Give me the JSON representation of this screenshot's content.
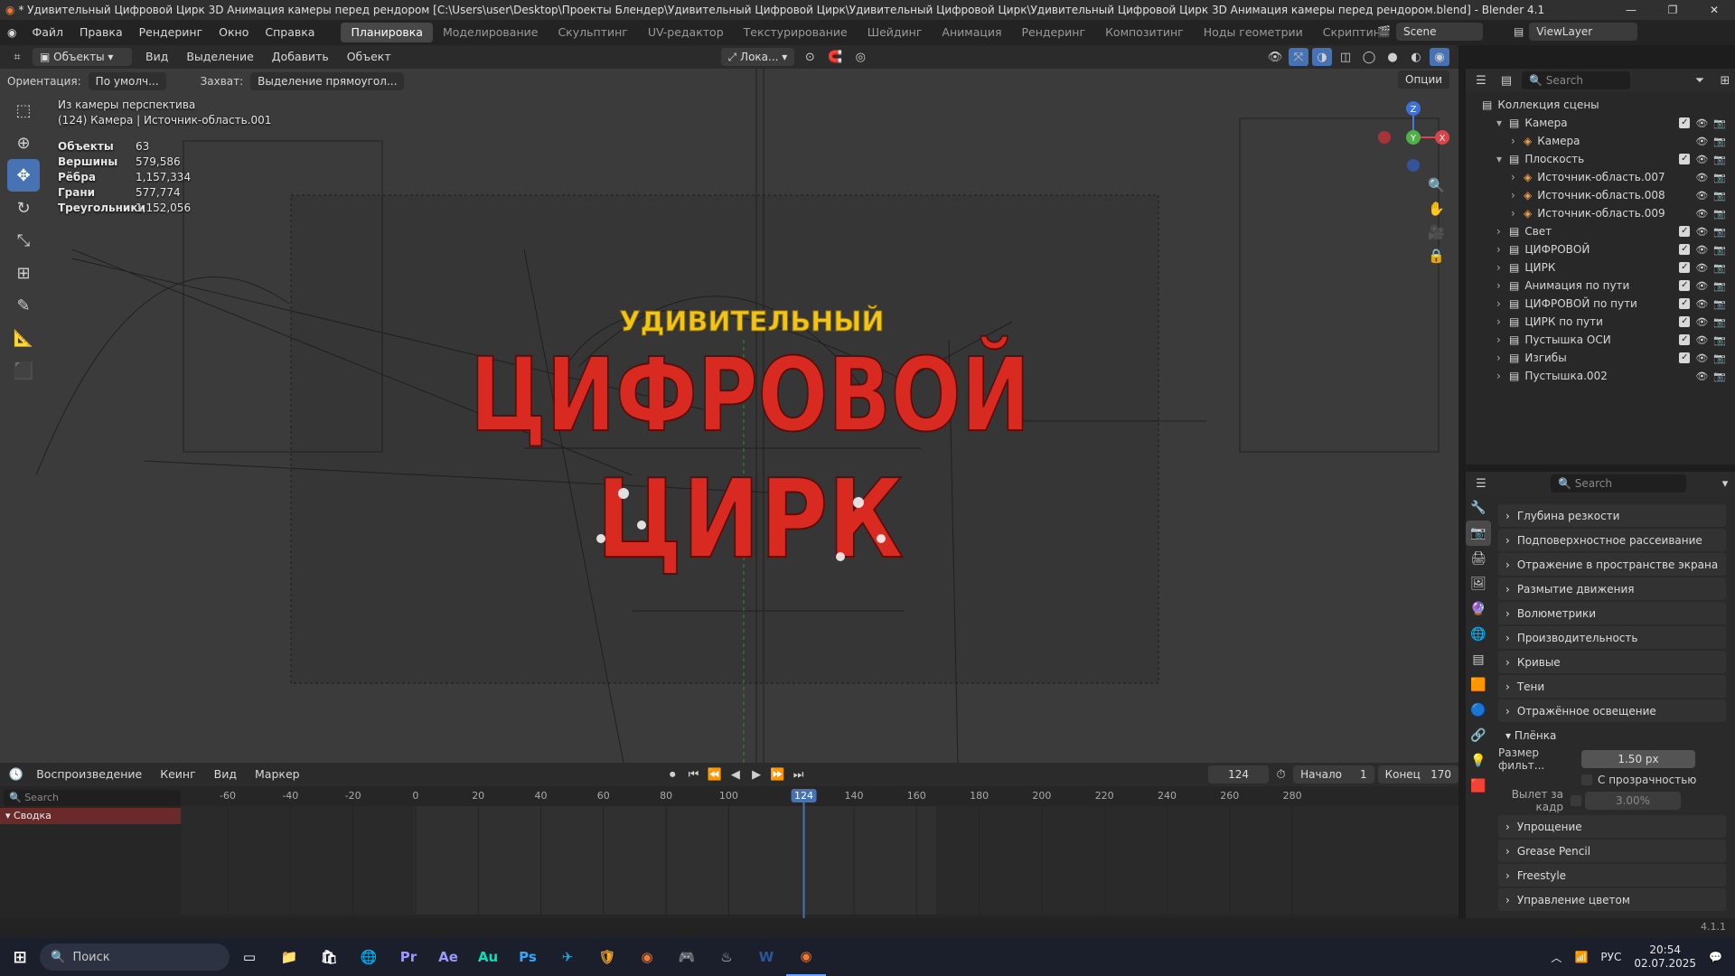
{
  "window": {
    "title": "* Удивительный Цифровой Цирк 3D Анимация камеры перед рендором [C:\\Users\\user\\Desktop\\Проекты Блендер\\Удивительный Цифровой Цирк\\Удивительный Цифровой Цирк\\Удивительный Цифровой Цирк 3D Анимация камеры перед рендором.blend] - Blender 4.1"
  },
  "menu": [
    "Файл",
    "Правка",
    "Рендеринг",
    "Окно",
    "Справка"
  ],
  "workspaces": [
    "Планировка",
    "Моделирование",
    "Скульптинг",
    "UV-редактор",
    "Текстурирование",
    "Шейдинг",
    "Анимация",
    "Рендеринг",
    "Композитинг",
    "Ноды геометрии",
    "Скриптинг"
  ],
  "active_workspace": "Планировка",
  "scene": {
    "label": "Scene",
    "view_layer": "ViewLayer"
  },
  "viewport_header": {
    "mode": "Объекты",
    "menus": [
      "Вид",
      "Выделение",
      "Добавить",
      "Объект"
    ],
    "transform": "Лока...",
    "orientation_label": "Ориентация:",
    "orientation_value": "По умолч...",
    "snap_label": "Захват:",
    "snap_value": "Выделение прямоугол...",
    "options": "Опции"
  },
  "viewport_overlay": {
    "line1": "Из камеры перспектива",
    "line2": "(124) Камера | Источник-область.001",
    "stats": [
      {
        "label": "Объекты",
        "value": "63"
      },
      {
        "label": "Вершины",
        "value": "579,586"
      },
      {
        "label": "Рёбра",
        "value": "1,157,334"
      },
      {
        "label": "Грани",
        "value": "577,774"
      },
      {
        "label": "Треугольники",
        "value": "1,152,056"
      }
    ],
    "scene_text": {
      "top": "УДИВИТЕЛЬНЫЙ",
      "middle": "ЦИФРОВОЙ",
      "bottom": "ЦИРК"
    }
  },
  "gizmo": {
    "x": "X",
    "y": "Y",
    "z": "Z"
  },
  "outliner": {
    "search_placeholder": "Search",
    "root": "Коллекция сцены",
    "rows": [
      {
        "label": "Камера",
        "depth": 1,
        "expanded": true,
        "check": true
      },
      {
        "label": "Камера",
        "depth": 2,
        "expanded": false,
        "check": false
      },
      {
        "label": "Плоскость",
        "depth": 1,
        "expanded": true,
        "check": true
      },
      {
        "label": "Источник-область.007",
        "depth": 2,
        "expanded": false,
        "check": false
      },
      {
        "label": "Источник-область.008",
        "depth": 2,
        "expanded": false,
        "check": false
      },
      {
        "label": "Источник-область.009",
        "depth": 2,
        "expanded": false,
        "check": false
      },
      {
        "label": "Свет",
        "depth": 1,
        "expanded": false,
        "check": true
      },
      {
        "label": "ЦИФРОВОЙ",
        "depth": 1,
        "expanded": false,
        "check": true
      },
      {
        "label": "ЦИРК",
        "depth": 1,
        "expanded": false,
        "check": true
      },
      {
        "label": "Анимация по пути",
        "depth": 1,
        "expanded": false,
        "check": true
      },
      {
        "label": "ЦИФРОВОЙ по пути",
        "depth": 1,
        "expanded": false,
        "check": true
      },
      {
        "label": "ЦИРК по пути",
        "depth": 1,
        "expanded": false,
        "check": true
      },
      {
        "label": "Пустышка ОСИ",
        "depth": 1,
        "expanded": false,
        "check": true
      },
      {
        "label": "Изгибы",
        "depth": 1,
        "expanded": false,
        "check": true
      },
      {
        "label": "Пустышка.002",
        "depth": 1,
        "expanded": false,
        "check": false
      }
    ]
  },
  "properties": {
    "search_placeholder": "Search",
    "panels": [
      "Глубина резкости",
      "Подповерхностное рассеивание",
      "Отражение в пространстве экрана",
      "Размытие движения",
      "Волюметрики",
      "Производительность",
      "Кривые",
      "Тени",
      "Отражённое освещение"
    ],
    "film": {
      "title": "Плёнка",
      "filter_label": "Размер фильт...",
      "filter_value": "1.50 px",
      "transparent_label": "С прозрачностью",
      "overscan_label": "Вылет за кадр",
      "overscan_value": "3.00%"
    },
    "panels_after": [
      "Упрощение",
      "Grease Pencil",
      "Freestyle",
      "Управление цветом"
    ]
  },
  "timeline": {
    "menus": [
      "Воспроизведение",
      "Кеинг",
      "Вид",
      "Маркер"
    ],
    "current_frame": "124",
    "start_label": "Начало",
    "start_value": "1",
    "end_label": "Конец",
    "end_value": "170",
    "search_placeholder": "Search",
    "summary": "Сводка",
    "ticks": [
      "-60",
      "-40",
      "-20",
      "0",
      "20",
      "40",
      "60",
      "80",
      "100",
      "124",
      "140",
      "160",
      "180",
      "200",
      "220",
      "240",
      "260",
      "280"
    ]
  },
  "statusbar": {
    "version": "4.1.1"
  },
  "taskbar": {
    "search": "Поиск",
    "apps": [
      "Pr",
      "Ae",
      "Au",
      "Ps"
    ],
    "lang": "РУС",
    "time": "20:54",
    "date": "02.07.2025"
  },
  "colors": {
    "accent": "#4772b3",
    "red": "#d92a22",
    "yellow": "#f0d21e",
    "blue": "#2266dd"
  }
}
